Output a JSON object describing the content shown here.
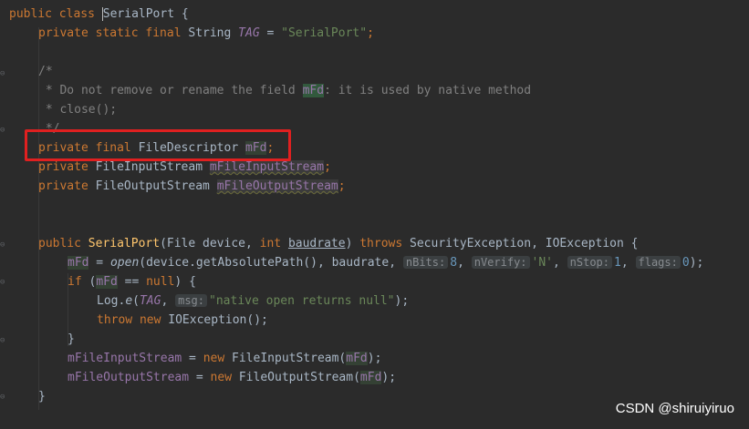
{
  "code": {
    "l1": {
      "kw1": "public",
      "kw2": "class",
      "name_first": "S",
      "name_rest": "erialPort",
      "brace": " {"
    },
    "l2": {
      "kw": "private static final",
      "type": " String ",
      "const": "TAG",
      "eq": " = ",
      "str": "\"SerialPort\"",
      "end": ";"
    },
    "l4": {
      "text": "/*"
    },
    "l5": {
      "pre": " * Do not remove or rename the field ",
      "field": "mFd",
      "post": ": it is used by native method"
    },
    "l6": {
      "text": " * close();"
    },
    "l7": {
      "text": " */"
    },
    "l8": {
      "kw": "private final",
      "type": " FileDescriptor ",
      "field": "mFd",
      "end": ";"
    },
    "l9": {
      "kw": "private",
      "type": " FileInputStream ",
      "field": "mFileInputStream",
      "end": ";"
    },
    "l10": {
      "kw": "private",
      "type": " FileOutputStream ",
      "field": "mFileOutputStream",
      "end": ";"
    },
    "l13": {
      "kw": "public",
      "fn": " SerialPort",
      "p1": "(File device, ",
      "kw_int": "int",
      "p2": " ",
      "param": "baudrate",
      "p3": ") ",
      "kw_throws": "throws",
      "p4": " SecurityException, IOException {"
    },
    "l14": {
      "field": "mFd",
      "p1": " = ",
      "call": "open",
      "p2": "(device.getAbsolutePath(), baudrate, ",
      "h1": "nBits:",
      "n1": "8",
      ",1": ", ",
      "h2": "nVerify:",
      "s2": "'N'",
      ",2": ", ",
      "h3": "nStop:",
      "n3": "1",
      ",3": ", ",
      "h4": "flags:",
      "n4": "0",
      "end": ");"
    },
    "l15": {
      "kw": "if",
      "p1": " (",
      "field": "mFd",
      "p2": " == ",
      "kw_null": "null",
      "p3": ") {"
    },
    "l16": {
      "p1": "Log.",
      "call": "e",
      "p2": "(",
      "const": "TAG",
      ",": ", ",
      "hint": "msg:",
      "str": "\"native open returns null\"",
      "end": ");"
    },
    "l17": {
      "kw": "throw",
      "kw2": " new",
      "p": " IOException();"
    },
    "l18": {
      "text": "}"
    },
    "l19": {
      "field": "mFileInputStream",
      "p1": " = ",
      "kw": "new",
      "p2": " FileInputStream(",
      "arg": "mFd",
      "end": ");"
    },
    "l20": {
      "field": "mFileOutputStream",
      "p1": " = ",
      "kw": "new",
      "p2": " FileOutputStream(",
      "arg": "mFd",
      "end": ");"
    },
    "l21": {
      "text": "}"
    }
  },
  "watermark": "CSDN @shiruiyiruo",
  "colors": {
    "keyword": "#cc7832",
    "string": "#6a8759",
    "comment": "#808080",
    "field": "#9876aa",
    "function": "#ffc66d",
    "number": "#6897bb",
    "highlight_box": "#e02020",
    "background": "#2b2b2b"
  }
}
